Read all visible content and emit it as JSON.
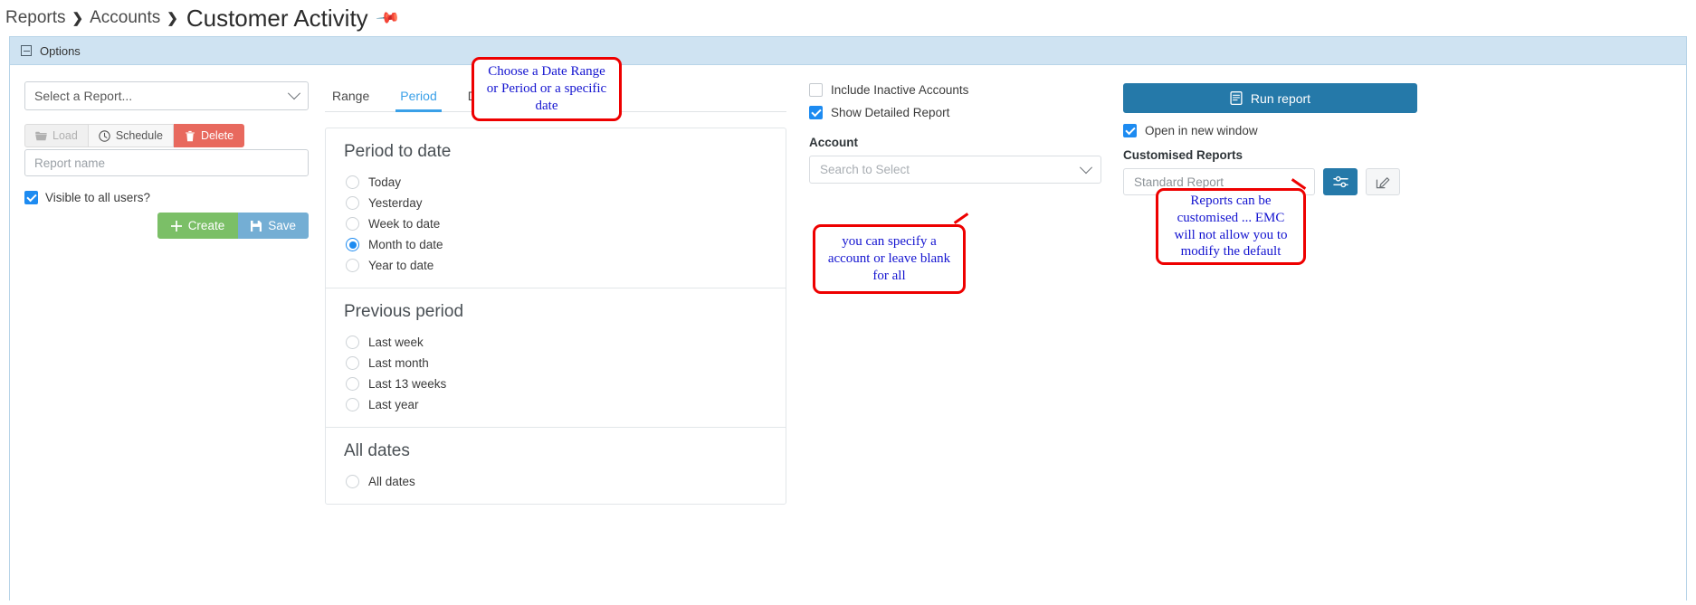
{
  "breadcrumb": {
    "items": [
      "Reports",
      "Accounts"
    ],
    "separator": "❯",
    "current": "Customer Activity",
    "pin_icon": "pin-icon"
  },
  "options_panel": {
    "header_title": "Options"
  },
  "reports_column": {
    "select_report_placeholder": "Select a Report...",
    "buttons": [
      {
        "label": "Load",
        "icon": "folder-icon",
        "state": "disabled"
      },
      {
        "label": "Schedule",
        "icon": "clock-icon",
        "state": "enabled"
      },
      {
        "label": "Delete",
        "icon": "trash-icon",
        "state": "danger"
      }
    ],
    "report_name_placeholder": "Report name",
    "visible_all_users_label": "Visible to all users?",
    "visible_all_users_checked": true,
    "create_label": "Create",
    "save_label": "Save"
  },
  "tabs": [
    {
      "label": "Range",
      "active": false
    },
    {
      "label": "Period",
      "active": true
    },
    {
      "label": "Date",
      "active": false
    }
  ],
  "period": {
    "sections": [
      {
        "title": "Period to date",
        "options": [
          {
            "label": "Today",
            "selected": false
          },
          {
            "label": "Yesterday",
            "selected": false
          },
          {
            "label": "Week to date",
            "selected": false
          },
          {
            "label": "Month to date",
            "selected": true
          },
          {
            "label": "Year to date",
            "selected": false
          }
        ]
      },
      {
        "title": "Previous period",
        "options": [
          {
            "label": "Last week",
            "selected": false
          },
          {
            "label": "Last month",
            "selected": false
          },
          {
            "label": "Last 13 weeks",
            "selected": false
          },
          {
            "label": "Last year",
            "selected": false
          }
        ]
      },
      {
        "title": "All dates",
        "options": [
          {
            "label": "All dates",
            "selected": false
          }
        ]
      }
    ]
  },
  "options_column": {
    "include_inactive_label": "Include Inactive Accounts",
    "include_inactive_checked": false,
    "show_detailed_label": "Show Detailed Report",
    "show_detailed_checked": true,
    "account_label": "Account",
    "account_placeholder": "Search to Select"
  },
  "run_column": {
    "run_report_label": "Run report",
    "run_report_icon": "report-icon",
    "open_new_window_label": "Open in new window",
    "open_new_window_checked": true,
    "customised_reports_label": "Customised Reports",
    "customised_report_value": "Standard Report",
    "settings_icon": "sliders-icon",
    "edit_icon": "pencil-square-icon"
  },
  "annotations": [
    {
      "id": "date-range",
      "text": "Choose a Date Range or Period or a specific date"
    },
    {
      "id": "account",
      "text": "you can specify a account or leave blank for all"
    },
    {
      "id": "customise",
      "text": "Reports can be customised ... EMC will not allow you to modify the default"
    }
  ],
  "colors": {
    "accent_blue": "#2579a9",
    "tab_active": "#3aa0e8",
    "danger": "#e8695e",
    "success": "#7bbf67",
    "save_blue": "#74aed4",
    "checkbox_blue": "#1d8bf1",
    "annotation_border": "#ee0000",
    "annotation_text": "#1414d0",
    "panel_header": "#cfe3f2"
  }
}
